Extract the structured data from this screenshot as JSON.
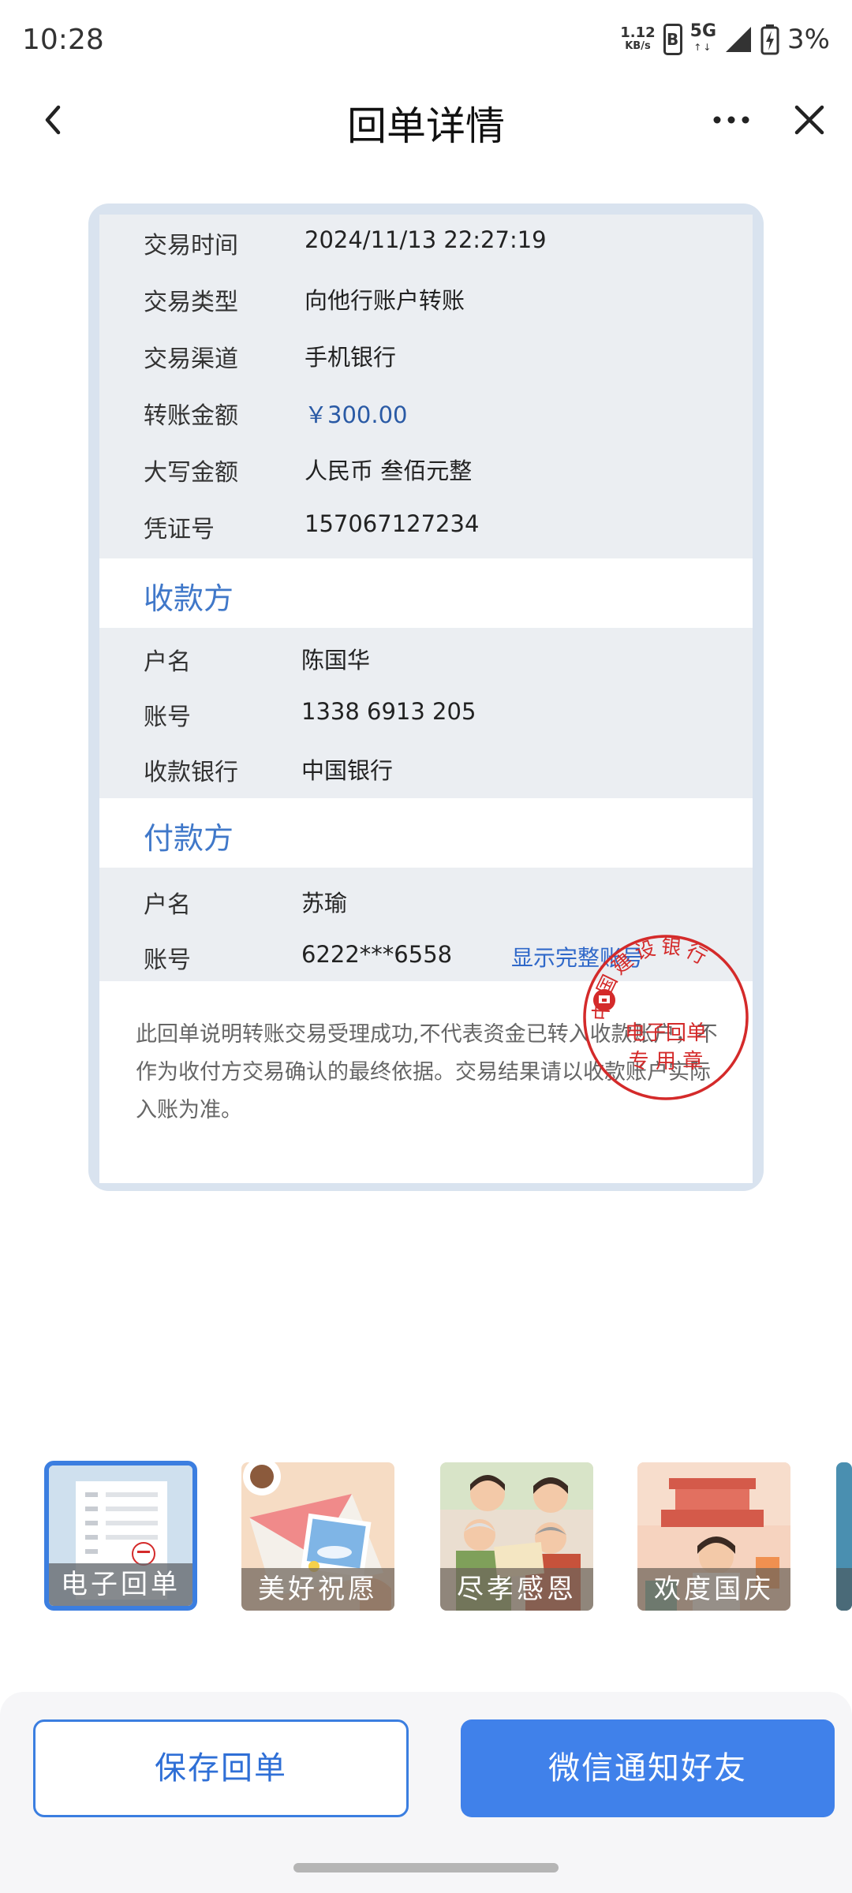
{
  "status_bar": {
    "time": "10:28",
    "net_speed_value": "1.12",
    "net_speed_unit": "KB/s",
    "hd_label": "B",
    "network_type": "5G",
    "network_arrows": "↑↓",
    "battery_percent": "3%"
  },
  "nav": {
    "title": "回单详情",
    "back_icon": "chevron-left-icon",
    "more_icon": "more-horizontal-icon",
    "close_icon": "close-icon"
  },
  "receipt": {
    "transaction": [
      {
        "label": "交易时间",
        "value": "2024/11/13 22:27:19"
      },
      {
        "label": "交易类型",
        "value": "向他行账户转账"
      },
      {
        "label": "交易渠道",
        "value": "手机银行"
      },
      {
        "label": "转账金额",
        "value": "￥300.00"
      },
      {
        "label": "大写金额",
        "value": "人民币 叁佰元整"
      },
      {
        "label": "凭证号",
        "value": "157067127234"
      }
    ],
    "payee_title": "收款方",
    "payee": [
      {
        "label": "户名",
        "value": "陈国华"
      },
      {
        "label": "账号",
        "value": "1338 6913 205"
      },
      {
        "label": "收款银行",
        "value": "中国银行"
      }
    ],
    "payer_title": "付款方",
    "payer": [
      {
        "label": "户名",
        "value": "苏瑜"
      },
      {
        "label": "账号",
        "value": "6222***6558"
      }
    ],
    "show_full_account": "显示完整账号",
    "disclaimer": "此回单说明转账交易受理成功,不代表资金已转入收款账户，不作为收付方交易确认的最终依据。交易结果请以收款账户实际入账为准。",
    "seal": {
      "bank_name": "中国建设银行",
      "line1": "电子回单",
      "line2": "专 用 章",
      "color": "#d42a2a"
    }
  },
  "templates": [
    {
      "label": "电子回单",
      "selected": true
    },
    {
      "label": "美好祝愿",
      "selected": false
    },
    {
      "label": "尽孝感恩",
      "selected": false
    },
    {
      "label": "欢度国庆",
      "selected": false
    }
  ],
  "actions": {
    "save_label": "保存回单",
    "share_label": "微信通知好友"
  },
  "colors": {
    "accent": "#4081ea",
    "section_title": "#4078c9",
    "card_border": "#d9e3ef",
    "row_background": "#ebeef2"
  }
}
